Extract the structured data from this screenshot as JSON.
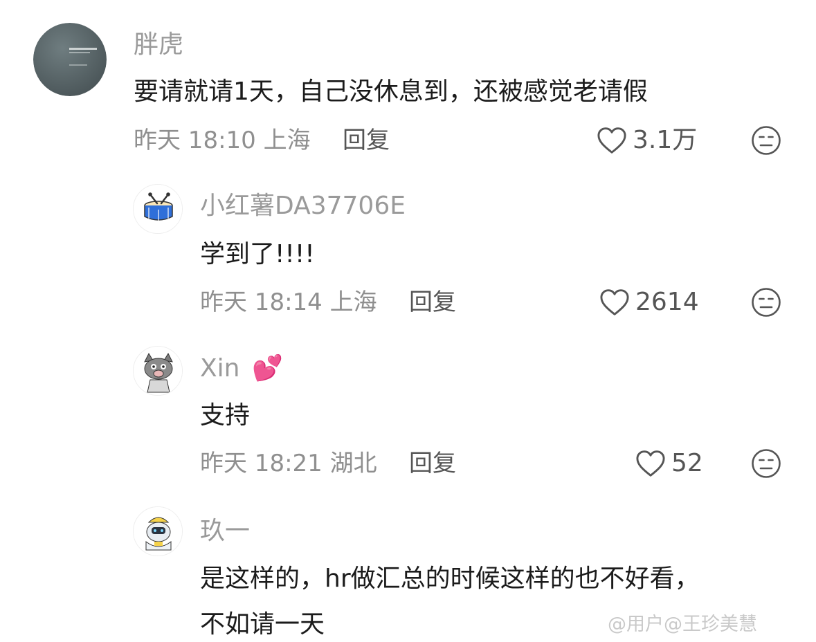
{
  "comments": [
    {
      "username": "胖虎",
      "text": "要请就请1天，自己没休息到，还被感觉老请假",
      "meta": "昨天 18:10 上海",
      "reply_label": "回复",
      "likes": "3.1万"
    },
    {
      "username": "小红薯DA37706E",
      "text": "学到了!!!!",
      "meta": "昨天 18:14 上海",
      "reply_label": "回复",
      "likes": "2614"
    },
    {
      "username": "Xin",
      "username_emoji": "💕",
      "text": "支持",
      "meta": "昨天 18:21 湖北",
      "reply_label": "回复",
      "likes": "52"
    },
    {
      "username": "玖一",
      "text_line1": "是这样的，hr做汇总的时候这样的也不好看，",
      "text_line2": "不如请一天"
    }
  ],
  "icons": {
    "like": "heart-outline-icon",
    "dislike": "meh-face-icon"
  },
  "watermark": "@用户@王珍美慧"
}
